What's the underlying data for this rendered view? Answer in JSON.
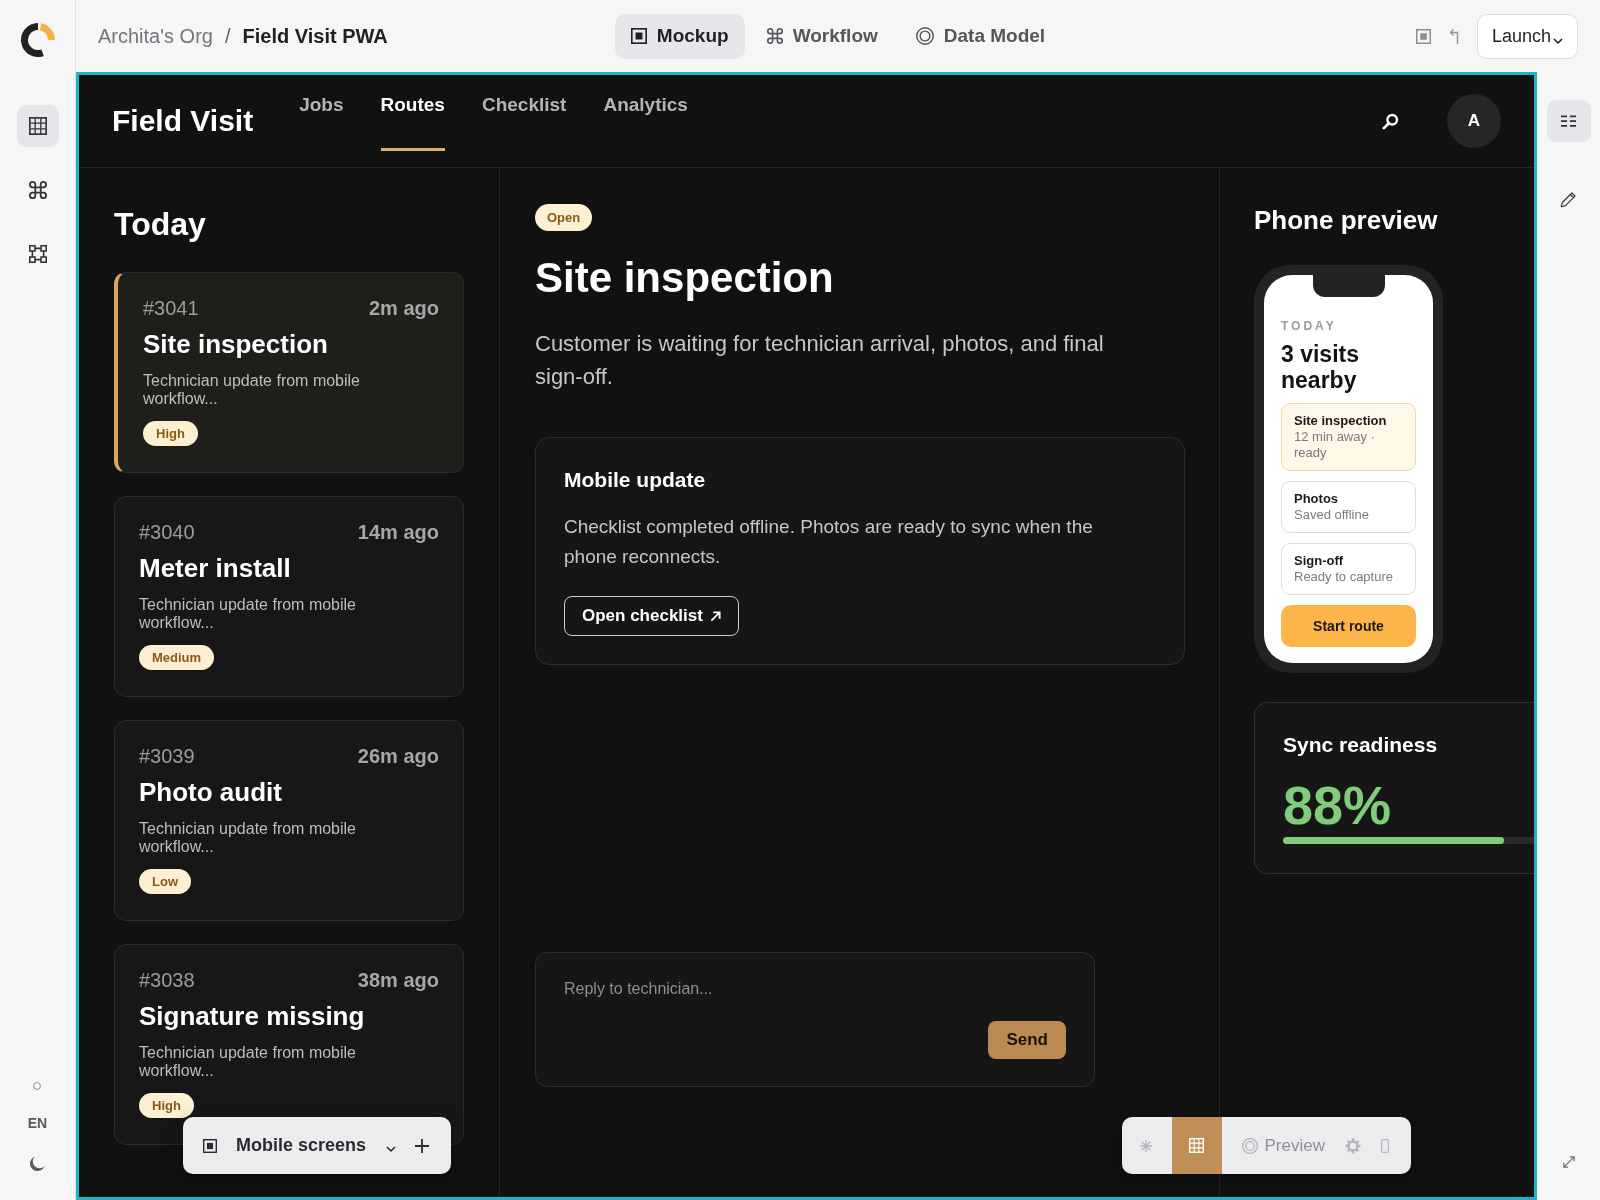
{
  "left_rail": {
    "items": [
      {
        "kind": "grid",
        "selected": true
      },
      {
        "kind": "command",
        "selected": false
      },
      {
        "kind": "linked",
        "selected": false
      }
    ],
    "language": "EN"
  },
  "top_bar": {
    "breadcrumb": {
      "org": "Archita's Org",
      "separator": "/",
      "project": "Field Visit PWA"
    },
    "modes": [
      {
        "kind": "mockup",
        "label": "Mockup",
        "selected": true
      },
      {
        "kind": "workflow",
        "label": "Workflow",
        "selected": false
      },
      {
        "kind": "data_model",
        "label": "Data Model",
        "selected": false
      }
    ],
    "launch_button": "Launch"
  },
  "app": {
    "title": "Field Visit",
    "nav": [
      {
        "label": "Jobs",
        "selected": false
      },
      {
        "label": "Routes",
        "selected": true
      },
      {
        "label": "Checklist",
        "selected": false
      },
      {
        "label": "Analytics",
        "selected": false
      }
    ],
    "avatar": "A"
  },
  "jobs": {
    "heading": "Today",
    "items": [
      {
        "id": "#3041",
        "time": "2m ago",
        "title": "Site inspection",
        "summary": "Technician update from mobile workflow...",
        "priority": "High",
        "selected": true
      },
      {
        "id": "#3040",
        "time": "14m ago",
        "title": "Meter install",
        "summary": "Technician update from mobile workflow...",
        "priority": "Medium",
        "selected": false
      },
      {
        "id": "#3039",
        "time": "26m ago",
        "title": "Photo audit",
        "summary": "Technician update from mobile workflow...",
        "priority": "Low",
        "selected": false
      },
      {
        "id": "#3038",
        "time": "38m ago",
        "title": "Signature missing",
        "summary": "Technician update from mobile workflow...",
        "priority": "High",
        "selected": false
      }
    ]
  },
  "detail": {
    "status": "Open",
    "title": "Site inspection",
    "description": "Customer is waiting for technician arrival, photos, and final sign-off.",
    "update_card": {
      "title": "Mobile update",
      "text": "Checklist completed offline. Photos are ready to sync when the phone reconnects.",
      "button": "Open checklist"
    },
    "reply": {
      "placeholder": "Reply to technician...",
      "button": "Send"
    }
  },
  "phone_preview": {
    "heading": "Phone preview",
    "eyebrow": "TODAY",
    "title": "3 visits nearby",
    "items": [
      {
        "title": "Site inspection",
        "subtitle": "12 min away · ready",
        "selected": true
      },
      {
        "title": "Photos",
        "subtitle": "Saved offline",
        "selected": false
      },
      {
        "title": "Sign-off",
        "subtitle": "Ready to capture",
        "selected": false
      }
    ],
    "button": "Start route"
  },
  "sync": {
    "title": "Sync readiness",
    "reading": "88%",
    "level": 0.88
  },
  "screens_toolbar": {
    "label": "Mobile screens"
  },
  "view_toolbar": {
    "items": [
      {
        "kind": "sparkle",
        "selected": false
      },
      {
        "kind": "grid",
        "selected": true
      },
      {
        "kind": "preview",
        "label": "Preview",
        "selected": false
      },
      {
        "kind": "gear",
        "selected": false
      },
      {
        "kind": "device",
        "selected": false
      }
    ]
  },
  "right_rail": {
    "items": [
      {
        "kind": "list",
        "selected": true
      },
      {
        "kind": "pencil",
        "selected": false
      }
    ]
  }
}
